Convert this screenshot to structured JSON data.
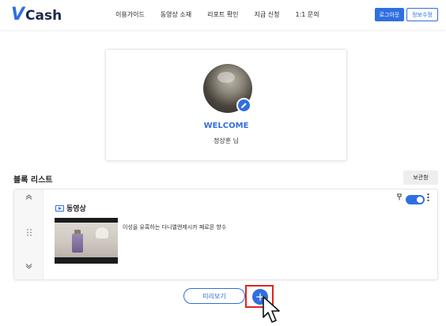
{
  "header": {
    "logo_v": "V",
    "logo_rest": "Cash",
    "nav": [
      "이용가이드",
      "동영상 소재",
      "리포트 확인",
      "지급 신청",
      "1:1 문의"
    ],
    "logout_label": "로그아웃",
    "info_label": "정보수정"
  },
  "profile": {
    "welcome": "WELCOME",
    "username": "정상훈 님"
  },
  "blocks": {
    "title": "블록 리스트",
    "storage_label": "보관함",
    "items": [
      {
        "type_label": "동영상",
        "description": "이성을 유혹하는 다니엘앤제시카 페로몬 향수",
        "enabled": true
      }
    ]
  },
  "footer": {
    "preview_label": "미리보기",
    "add_label": "+"
  },
  "colors": {
    "accent": "#2f6fe0",
    "highlight": "#e0251b"
  },
  "icons": {
    "edit": "pencil-icon",
    "video": "video-icon",
    "pin": "pin-icon",
    "more": "more-vertical-icon",
    "move_up": "chevron-up-icon",
    "move_down": "chevron-down-icon",
    "drag": "drag-handle-icon"
  }
}
